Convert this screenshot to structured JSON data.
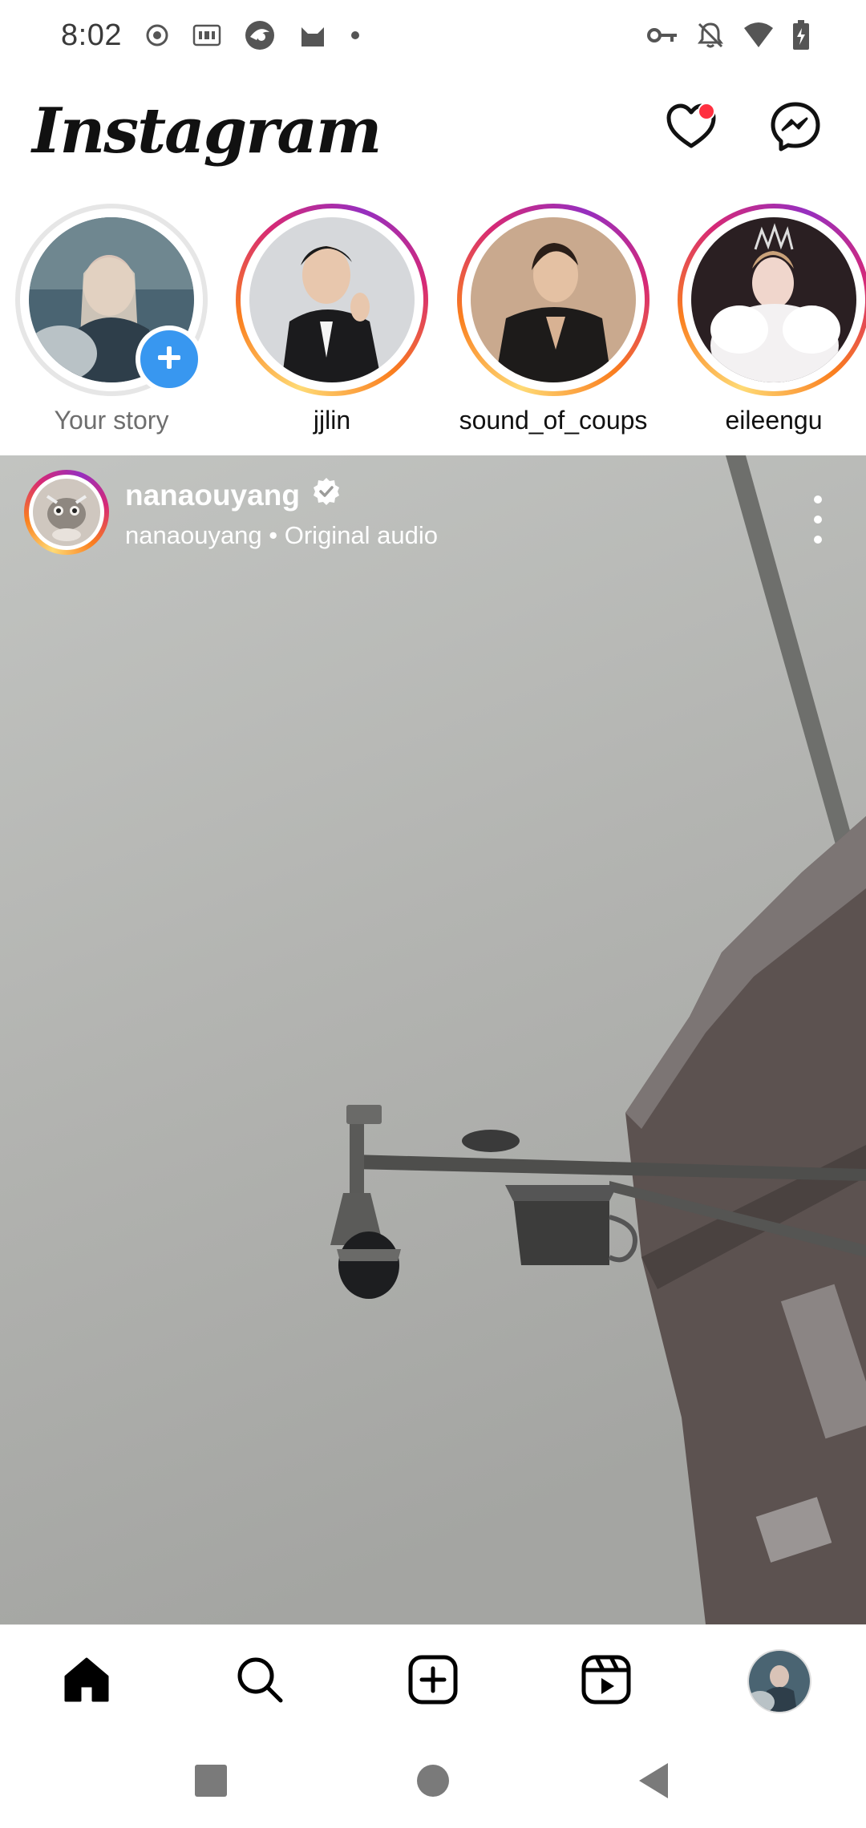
{
  "status_bar": {
    "time": "8:02",
    "left_icons": [
      "record-icon",
      "iqiyi-icon",
      "browser-app-icon",
      "cat-app-icon",
      "dot-icon"
    ],
    "right_icons": [
      "vpn-key-icon",
      "notifications-off-icon",
      "wifi-icon",
      "battery-charging-icon"
    ]
  },
  "header": {
    "logo": "Instagram",
    "actions": [
      "heart-icon",
      "messenger-icon"
    ],
    "notification_dot_color": "#ff3040"
  },
  "stories": [
    {
      "label": "Your story",
      "own": true
    },
    {
      "label": "jjlin",
      "own": false
    },
    {
      "label": "sound_of_coups",
      "own": false
    },
    {
      "label": "eileengu",
      "own": false
    }
  ],
  "post": {
    "username": "nanaouyang",
    "verified": true,
    "subtitle": "nanaouyang • Original audio"
  },
  "bottom_nav": [
    "home-icon",
    "search-icon",
    "create-icon",
    "reels-icon",
    "profile-avatar"
  ],
  "system_nav": [
    "recents-button",
    "home-button",
    "back-button"
  ],
  "colors": {
    "accent_blue": "#3897f0",
    "story_gradient": [
      "#feda75",
      "#fa7e1e",
      "#d62976",
      "#962fbf"
    ]
  }
}
